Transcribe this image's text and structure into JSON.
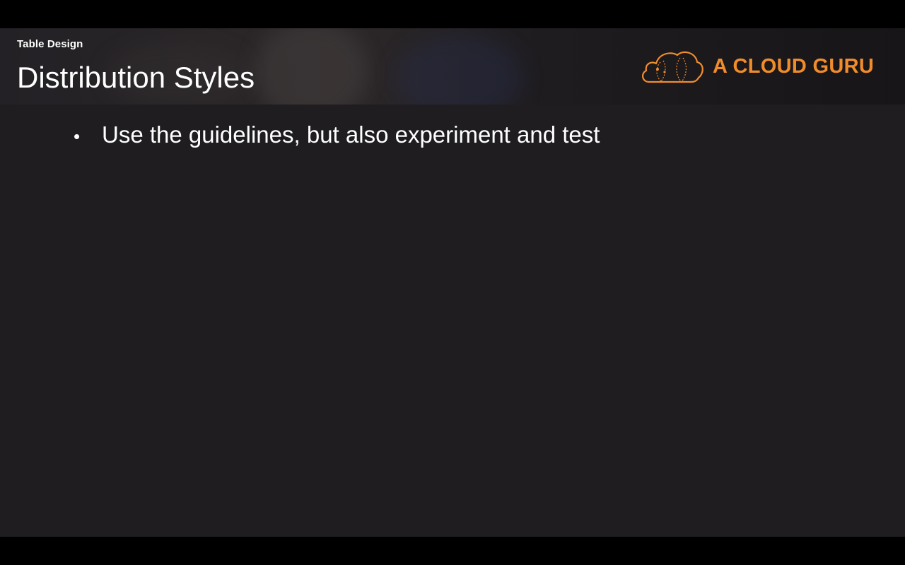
{
  "slide": {
    "section_label": "Table Design",
    "title": "Distribution Styles",
    "logo": {
      "icon": "cloud-icon",
      "text": "A CLOUD GURU",
      "color": "#f18c2c"
    },
    "bullets": [
      {
        "marker": "•",
        "text": "Use the guidelines, but also experiment and test"
      }
    ]
  },
  "colors": {
    "slide_background": "#1f1d20",
    "letterbox": "#000000",
    "text": "#ffffff",
    "accent": "#f18c2c"
  }
}
